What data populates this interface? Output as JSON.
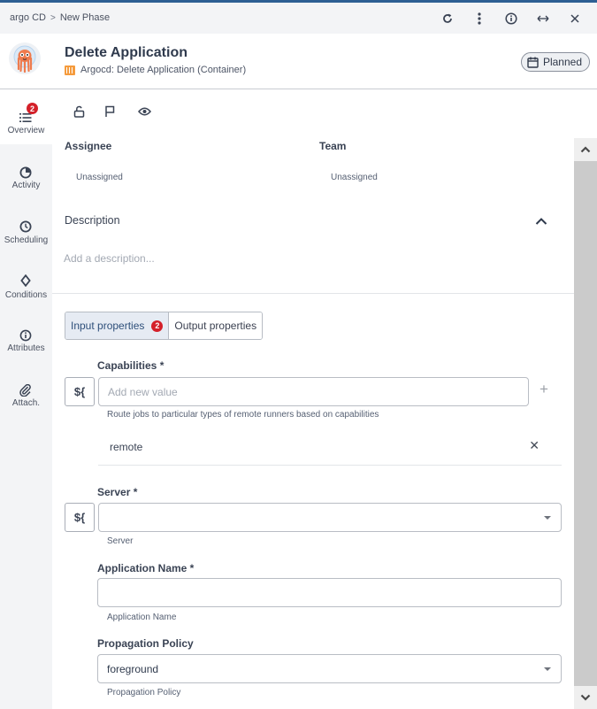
{
  "breadcrumb": {
    "parent": "argo CD",
    "separator": ">",
    "current": "New Phase"
  },
  "top_actions": [
    "refresh-icon",
    "more-vertical-icon",
    "info-icon",
    "expand-horizontal-icon",
    "close-icon"
  ],
  "header": {
    "title": "Delete Application",
    "subtitle": "Argocd: Delete Application (Container)",
    "status": "Planned",
    "task_type_color": "#f59b3d"
  },
  "sidebar": {
    "items": [
      {
        "label": "Overview",
        "icon": "list-icon",
        "badge": "2",
        "active": true
      },
      {
        "label": "Activity",
        "icon": "activity-icon"
      },
      {
        "label": "Scheduling",
        "icon": "clock-icon"
      },
      {
        "label": "Conditions",
        "icon": "diamond-icon"
      },
      {
        "label": "Attributes",
        "icon": "info-icon"
      },
      {
        "label": "Attach.",
        "icon": "paperclip-icon"
      }
    ]
  },
  "actions": [
    "unlock-icon",
    "flag-icon",
    "eye-icon"
  ],
  "assignee": {
    "label": "Assignee",
    "value": "Unassigned"
  },
  "team": {
    "label": "Team",
    "value": "Unassigned"
  },
  "description": {
    "label": "Description",
    "placeholder": "Add a description..."
  },
  "tabs": [
    {
      "label": "Input properties",
      "badge": "2",
      "active": true
    },
    {
      "label": "Output properties"
    }
  ],
  "form": {
    "expression_label": "${",
    "capabilities": {
      "label": "Capabilities *",
      "placeholder": "Add new value",
      "help": "Route jobs to particular types of remote runners based on capabilities",
      "values": [
        "remote"
      ]
    },
    "server": {
      "label": "Server *",
      "value": "",
      "help": "Server"
    },
    "application_name": {
      "label": "Application Name *",
      "value": "",
      "help": "Application Name"
    },
    "propagation_policy": {
      "label": "Propagation Policy",
      "value": "foreground",
      "help": "Propagation Policy"
    }
  },
  "colors": {
    "accent": "#2d5f93",
    "badge": "#d42029"
  }
}
